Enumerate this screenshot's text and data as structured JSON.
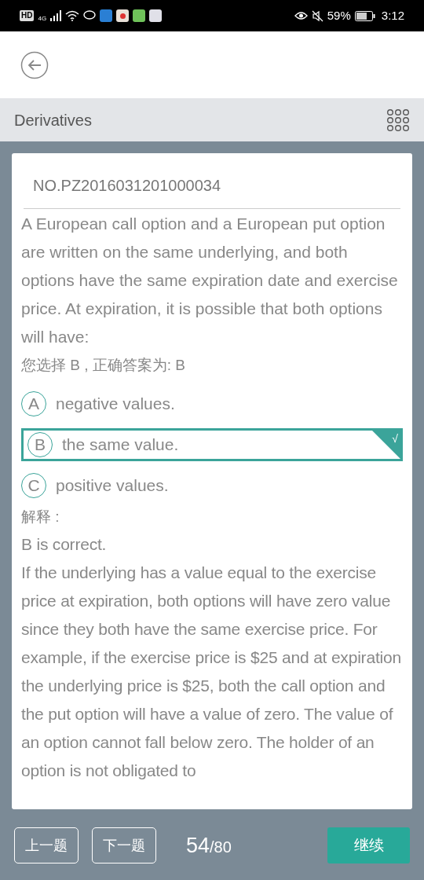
{
  "status_bar": {
    "hd": "HD",
    "network": "4G",
    "battery": "59%",
    "time": "3:12"
  },
  "subject": "Derivatives",
  "question_no": "NO.PZ2016031201000034",
  "question": "A European call option and a European put option are written on the same underlying, and both options have the same expiration date and exercise price. At expiration, it is possible that both options will have:",
  "result_line": "您选择 B , 正确答案为: B",
  "options": [
    {
      "letter": "A",
      "text": "negative values.",
      "selected": false
    },
    {
      "letter": "B",
      "text": "the same value.",
      "selected": true
    },
    {
      "letter": "C",
      "text": "positive values.",
      "selected": false
    }
  ],
  "check_mark": "√",
  "explanation_label": "解释 :",
  "explanation": [
    "B is correct.",
    "If the underlying has a value equal to the exercise price at expiration, both options will have zero value since they both have the same exercise price. For example, if the exercise price is $25 and at expiration the underlying price is $25, both the call option and the put option will have a value of zero. The value of an option cannot fall below zero. The holder of an option is not obligated to"
  ],
  "footer": {
    "prev": "上一题",
    "next": "下一题",
    "current": "54",
    "total": "/80",
    "continue": "继续"
  }
}
